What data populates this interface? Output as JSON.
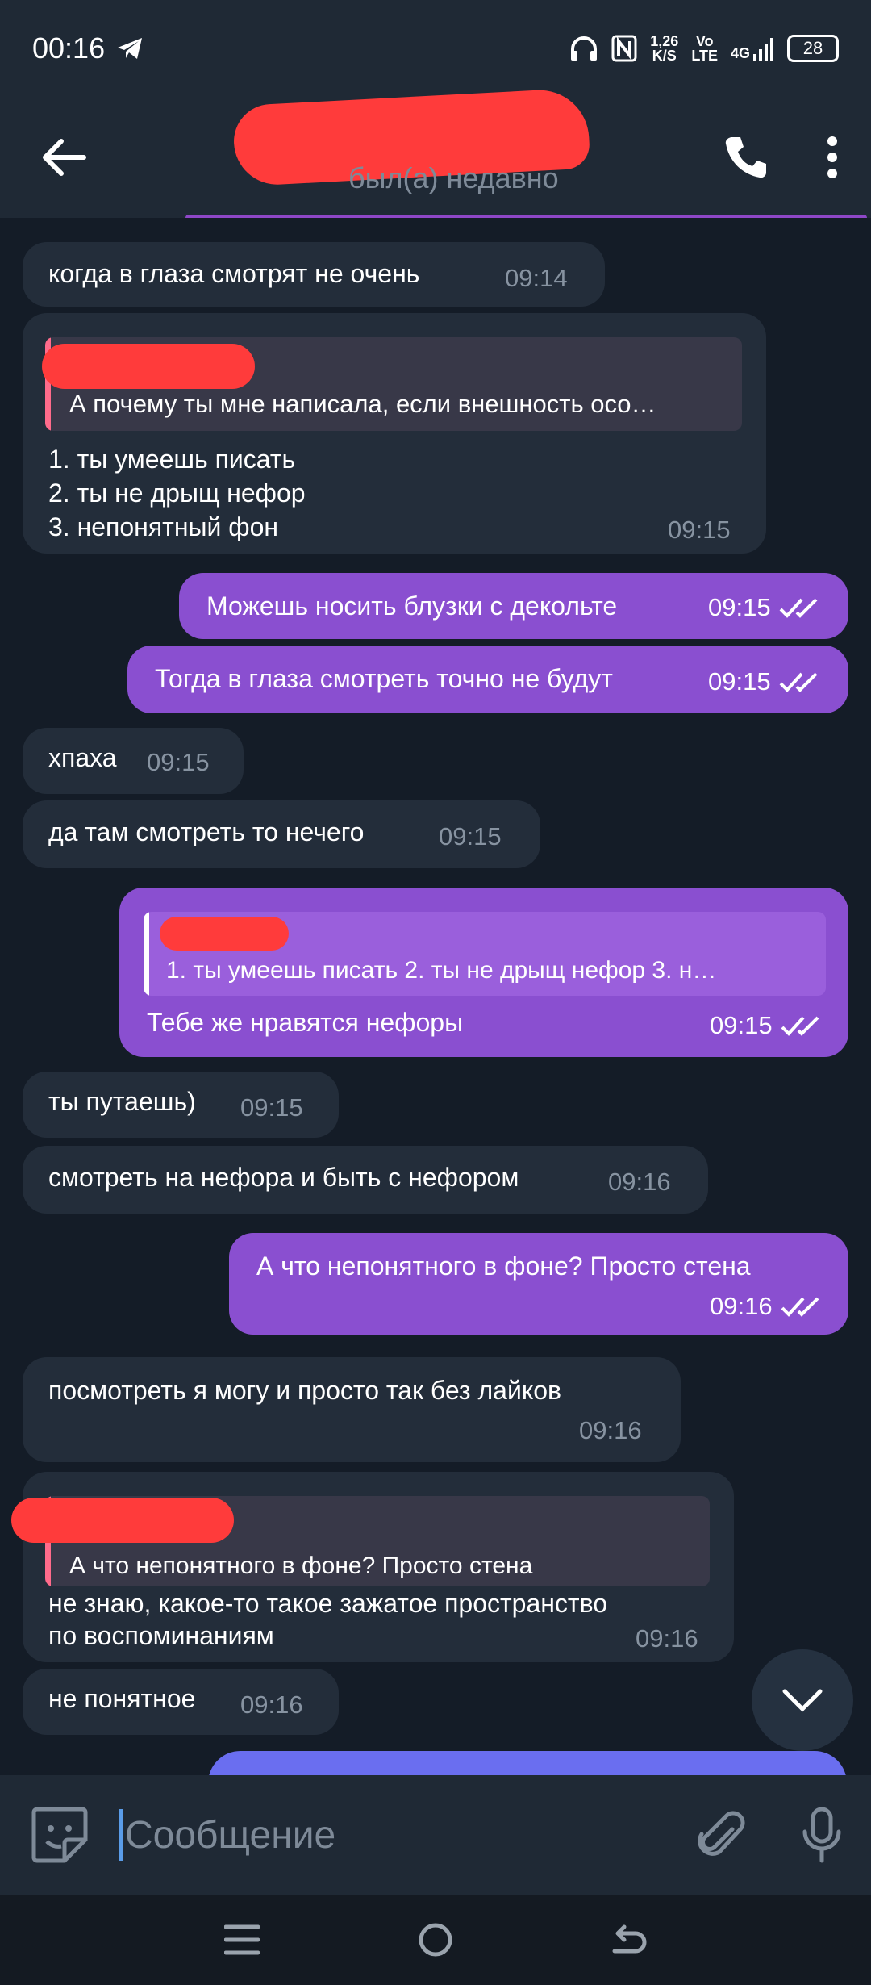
{
  "status_bar": {
    "time": "00:16",
    "speed": "1,26",
    "speed_unit": "K/S",
    "volte_top": "Vo",
    "volte_bottom": "LTE",
    "network": "4G",
    "battery": "28"
  },
  "header": {
    "status": "был(а) недавно"
  },
  "messages": [
    {
      "dir": "in",
      "text": "когда в глаза смотрят не очень",
      "time": "09:14"
    },
    {
      "dir": "in",
      "reply": "А почему ты мне написала, если внешность осо…",
      "lines": [
        "1. ты умеешь писать",
        "2. ты не дрыщ нефор",
        "3. непонятный фон"
      ],
      "time": "09:15"
    },
    {
      "dir": "out",
      "text": "Можешь носить блузки с декольте",
      "time": "09:15"
    },
    {
      "dir": "out",
      "text": "Тогда в глаза смотреть точно не будут",
      "time": "09:15"
    },
    {
      "dir": "in",
      "text": "хпаха",
      "time": "09:15"
    },
    {
      "dir": "in",
      "text": "да там смотреть то нечего",
      "time": "09:15"
    },
    {
      "dir": "out",
      "reply": "1. ты умеешь писать  2. ты не дрыщ нефор  3. н…",
      "text": "Тебе же нравятся нефоры",
      "time": "09:15"
    },
    {
      "dir": "in",
      "text": "ты путаешь)",
      "time": "09:15"
    },
    {
      "dir": "in",
      "text": "смотреть на нефора и быть с нефором",
      "time": "09:16"
    },
    {
      "dir": "out",
      "text": "А что непонятного в фоне? Просто стена",
      "time": "09:16"
    },
    {
      "dir": "in",
      "text": "посмотреть я могу и просто так без лайков",
      "time": "09:16"
    },
    {
      "dir": "in",
      "reply": "А что непонятного в фоне? Просто стена",
      "lines": [
        "не знаю, какое-то такое зажатое пространство",
        "по воспоминаниям"
      ],
      "time": "09:16"
    },
    {
      "dir": "in",
      "text": "не понятное",
      "time": "09:16"
    }
  ],
  "input": {
    "placeholder": "Сообщение"
  },
  "colors": {
    "incoming": "#232d3a",
    "outgoing": "#8a4fd0",
    "background": "#141c27",
    "header": "#1f2935"
  }
}
